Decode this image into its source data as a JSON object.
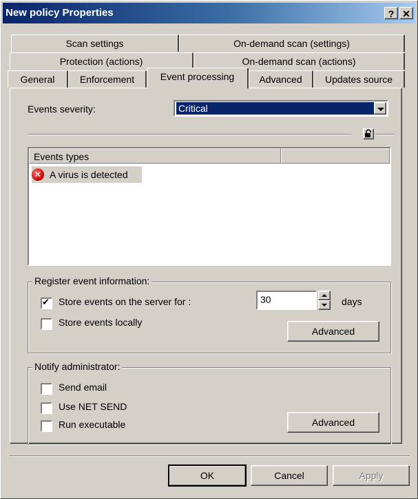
{
  "window": {
    "title": "New policy Properties",
    "help_label": "?",
    "close_label": "✕"
  },
  "tabs": {
    "row1": [
      "Scan settings",
      "On-demand scan (settings)"
    ],
    "row2": [
      "Protection (actions)",
      "On-demand scan (actions)"
    ],
    "row3": [
      "General",
      "Enforcement",
      "Event processing",
      "Advanced",
      "Updates source"
    ],
    "active": "Event processing"
  },
  "events": {
    "severity_label": "Events severity:",
    "severity_value": "Critical",
    "list_header": "Events types",
    "items": [
      {
        "label": "A virus is detected",
        "icon": "error-icon"
      }
    ]
  },
  "register": {
    "legend": "Register event information:",
    "store_server_label": "Store events on the server for :",
    "store_server_checked": true,
    "days_value": "30",
    "days_label": "days",
    "store_locally_label": "Store events locally",
    "store_locally_checked": false,
    "advanced_label": "Advanced"
  },
  "notify": {
    "legend": "Notify administrator:",
    "send_email_label": "Send email",
    "net_send_label": "Use NET SEND",
    "run_exec_label": "Run executable",
    "advanced_label": "Advanced"
  },
  "footer": {
    "ok_label": "OK",
    "cancel_label": "Cancel",
    "apply_label": "Apply"
  }
}
